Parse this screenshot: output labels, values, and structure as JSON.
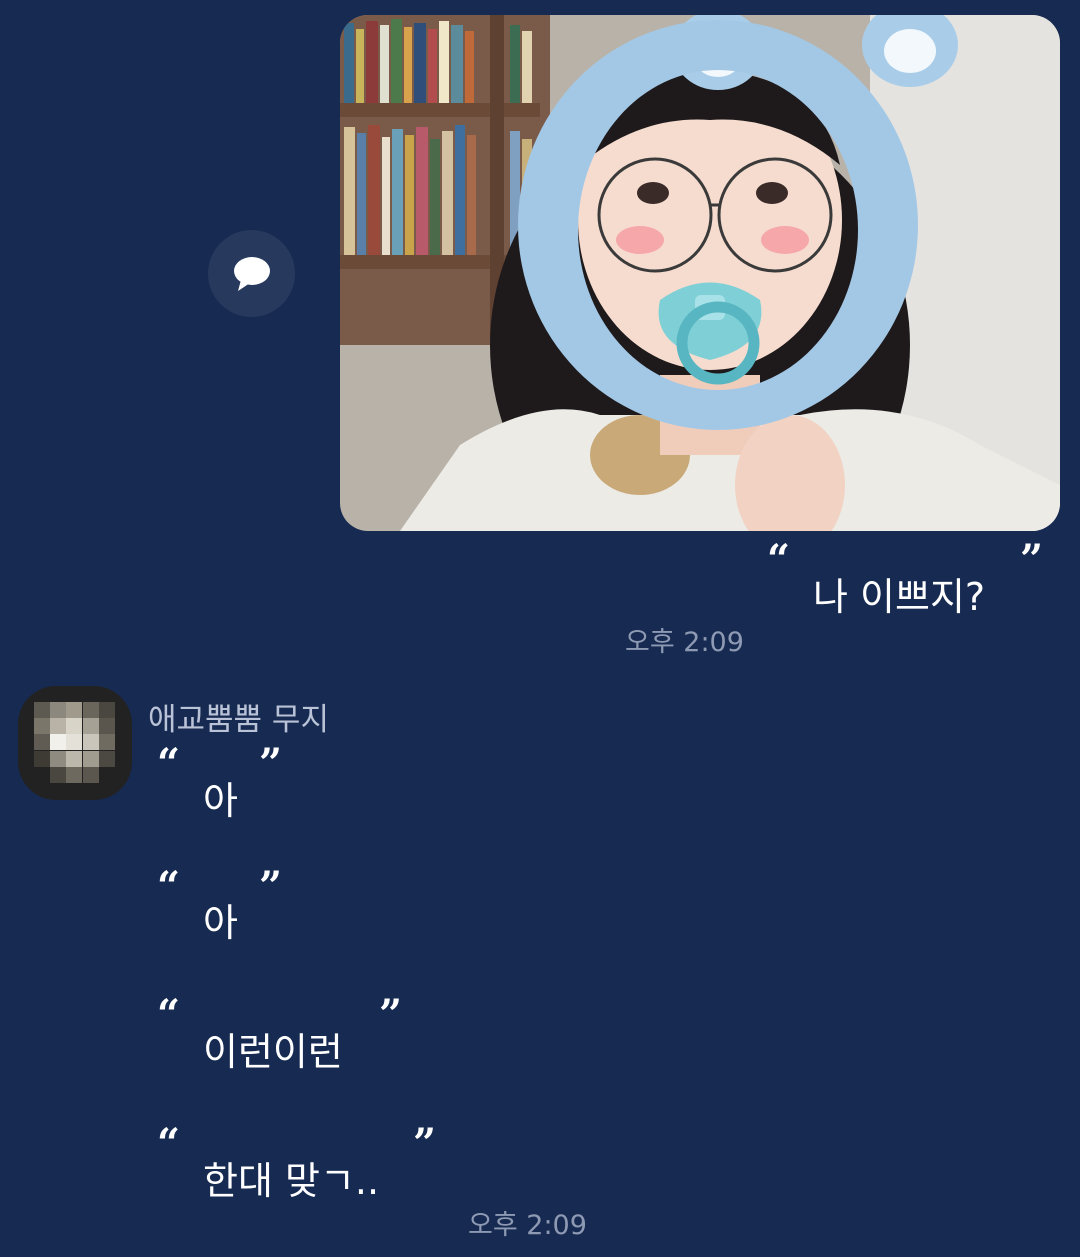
{
  "chat": {
    "background": "#172a51",
    "outgoing": {
      "photo_alt": "selfie with blue bear-ear face filter and pacifier",
      "text": "나 이쁘지?",
      "time": "오후 2:09"
    },
    "incoming": {
      "sender_name": "애교뿜뿜 무지",
      "messages": [
        {
          "text": "아"
        },
        {
          "text": "아"
        },
        {
          "text": "이런이런"
        },
        {
          "text": "한대 맞ㄱ.."
        }
      ],
      "time": "오후 2:09"
    }
  },
  "quote_open": "“",
  "quote_close": "”",
  "icons": {
    "share": "speech-bubble-icon"
  }
}
